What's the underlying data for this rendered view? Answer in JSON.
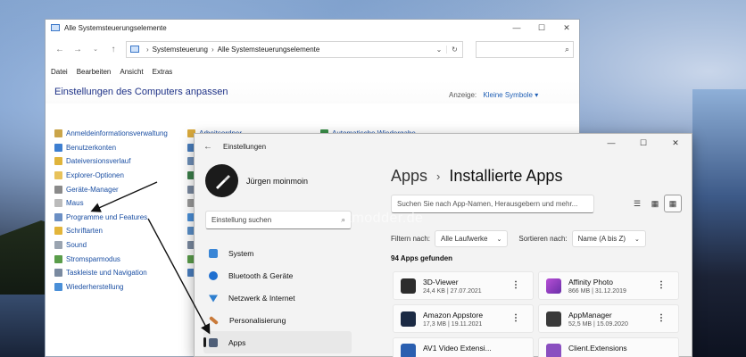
{
  "control_panel": {
    "title": "Alle Systemsteuerungselemente",
    "breadcrumb": [
      "Systemsteuerung",
      "Alle Systemsteuerungselemente"
    ],
    "menu": [
      "Datei",
      "Bearbeiten",
      "Ansicht",
      "Extras"
    ],
    "heading": "Einstellungen des Computers anpassen",
    "view_label": "Anzeige:",
    "view_value": "Kleine Symbole",
    "items_col1": [
      "Anmeldeinformationsverwaltung",
      "Benutzerkonten",
      "Dateiversionsverlauf",
      "Explorer-Optionen",
      "Geräte-Manager",
      "Maus",
      "Programme und Features",
      "Schriftarten",
      "Sound",
      "Stromsparmodus",
      "Taskleiste und Navigation",
      "Wiederherstellung"
    ],
    "items_col2": [
      "Arbeitsordner"
    ],
    "items_col3": [
      "Automatische Wiedergabe"
    ]
  },
  "watermark": "Deskmodder.de",
  "settings": {
    "title": "Einstellungen",
    "user_name": "Jürgen moinmoin",
    "search_placeholder": "Einstellung suchen",
    "nav": [
      "System",
      "Bluetooth & Geräte",
      "Netzwerk & Internet",
      "Personalisierung",
      "Apps"
    ],
    "breadcrumb_parent": "Apps",
    "breadcrumb_current": "Installierte Apps",
    "app_search_placeholder": "Suchen Sie nach App-Namen, Herausgebern und mehr...",
    "filter_label": "Filtern nach:",
    "filter_value": "Alle Laufwerke",
    "sort_label": "Sortieren nach:",
    "sort_value": "Name (A bis Z)",
    "count": "94 Apps gefunden",
    "apps": [
      {
        "name": "3D-Viewer",
        "size": "24,4 KB",
        "date": "27.07.2021"
      },
      {
        "name": "Affinity Photo",
        "size": "866 MB",
        "date": "31.12.2019"
      },
      {
        "name": "Amazon Appstore",
        "size": "17,3 MB",
        "date": "19.11.2021"
      },
      {
        "name": "AppManager",
        "size": "52,5 MB",
        "date": "15.09.2020"
      },
      {
        "name": "AV1 Video Extensi...",
        "size": "",
        "date": ""
      },
      {
        "name": "Client.Extensions",
        "size": "",
        "date": ""
      }
    ]
  }
}
